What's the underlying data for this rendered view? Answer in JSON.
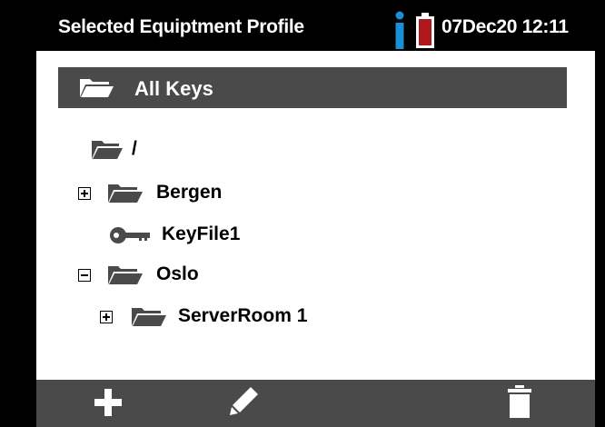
{
  "status_bar": {
    "title": "Selected Equiptment Profile",
    "datetime": "07Dec20 12:11",
    "icons": [
      "info-icon",
      "battery-icon"
    ],
    "battery_color": "#b0171b",
    "info_color": "#1a8fd6"
  },
  "tree_header": {
    "label": "All Keys",
    "icon": "folder-icon"
  },
  "tree": [
    {
      "label": "/",
      "type": "folder",
      "expander": "none"
    },
    {
      "label": "Bergen",
      "type": "folder",
      "expander": "plus"
    },
    {
      "label": "KeyFile1",
      "type": "key"
    },
    {
      "label": "Oslo",
      "type": "folder",
      "expander": "minus"
    },
    {
      "label": "ServerRoom 1",
      "type": "folder",
      "expander": "plus"
    }
  ],
  "toolbar": {
    "buttons": [
      "add-icon",
      "edit-icon",
      "delete-icon"
    ]
  }
}
